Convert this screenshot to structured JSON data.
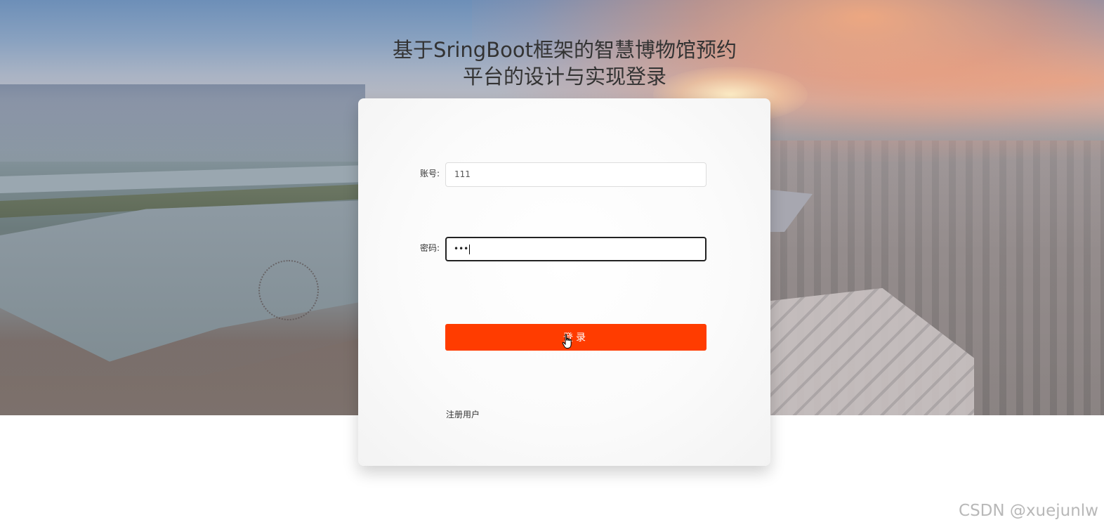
{
  "page": {
    "title_line1": "基于SringBoot框架的智慧博物馆预约",
    "title_line2": "平台的设计与实现登录"
  },
  "login_form": {
    "account_label": "账号:",
    "account_value": "111",
    "password_label": "密码:",
    "password_value": "•••",
    "login_button_label": "登录",
    "register_link_label": "注册用户"
  },
  "watermark": "CSDN @xuejunlw",
  "colors": {
    "login_button": "#ff3c00",
    "title_text": "#333333"
  },
  "icons": {
    "cursor": "hand-pointer-icon"
  }
}
